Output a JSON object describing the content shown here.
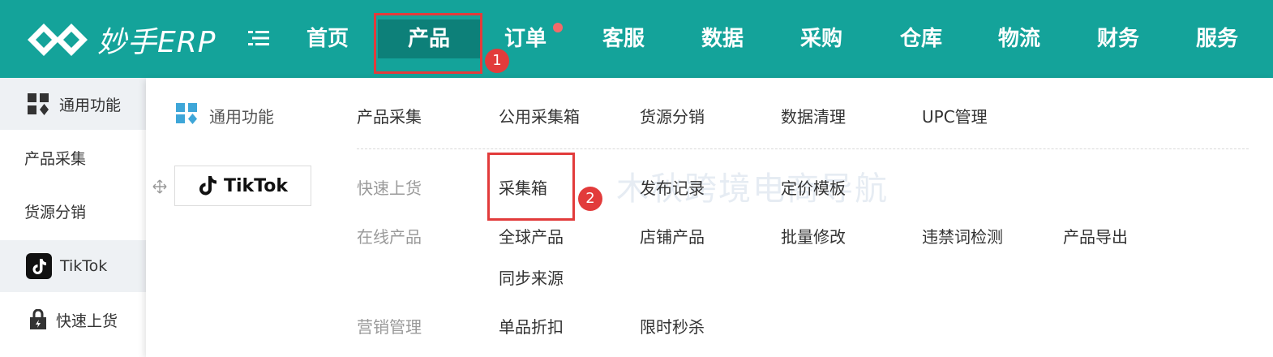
{
  "header": {
    "logo_text": "妙手ERP",
    "nav": [
      "首页",
      "产品",
      "订单",
      "客服",
      "数据",
      "采购",
      "仓库",
      "物流",
      "财务",
      "服务"
    ],
    "active": "产品",
    "accent": "#14a39a"
  },
  "annotations": {
    "badge1": "1",
    "badge2": "2"
  },
  "sidebar": {
    "items": [
      {
        "label": "通用功能",
        "icon": "grid-icon"
      },
      {
        "label": "产品采集"
      },
      {
        "label": "货源分销"
      },
      {
        "label": "TikTok",
        "icon": "tiktok-icon"
      },
      {
        "label": "快速上货",
        "icon": "lock-bag-icon"
      }
    ]
  },
  "dropdown": {
    "left_title": "通用功能",
    "platform": "TikTok",
    "common_links": [
      "产品采集",
      "公用采集箱",
      "货源分销",
      "数据清理",
      "UPC管理"
    ],
    "sections": [
      {
        "title": "快速上货",
        "links": [
          "采集箱",
          "发布记录",
          "定价模板"
        ]
      },
      {
        "title": "在线产品",
        "links": [
          "全球产品",
          "店铺产品",
          "批量修改",
          "违禁词检测",
          "产品导出",
          "同步来源"
        ]
      },
      {
        "title": "营销管理",
        "links": [
          "单品折扣",
          "限时秒杀"
        ]
      }
    ],
    "watermark": "木秋跨境电商导航"
  }
}
